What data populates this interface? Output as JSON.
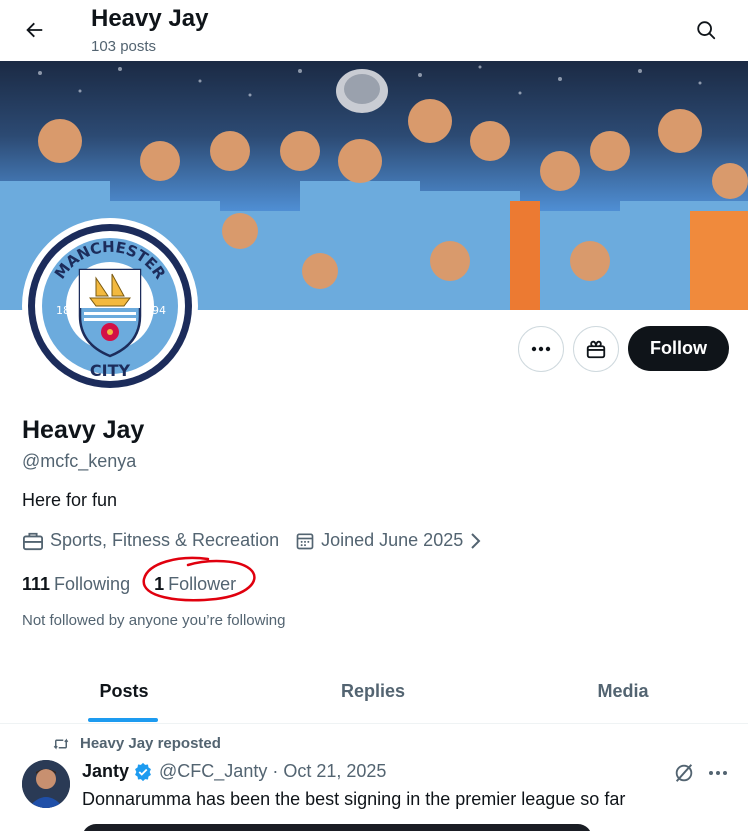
{
  "header": {
    "title": "Heavy Jay",
    "post_count": "103 posts"
  },
  "profile": {
    "display_name": "Heavy Jay",
    "handle": "@mcfc_kenya",
    "bio": "Here for fun",
    "category": "Sports, Fitness & Recreation",
    "joined": "Joined June 2025",
    "following_count": "111",
    "following_label": "Following",
    "followers_count": "1",
    "followers_label": "Follower",
    "not_followed_note": "Not followed by anyone you’re following",
    "follow_label": "Follow"
  },
  "crest": {
    "top_text": "MANCHESTER",
    "bottom_text": "CITY",
    "left_num": "18",
    "right_num": "94"
  },
  "tabs": [
    {
      "label": "Posts",
      "active": true
    },
    {
      "label": "Replies",
      "active": false
    },
    {
      "label": "Media",
      "active": false
    }
  ],
  "tweet": {
    "repost_label": "Heavy Jay reposted",
    "author_name": "Janty",
    "author_handle": "@CFC_Janty",
    "separator": "·",
    "date": "Oct 21, 2025",
    "text": "Donnarumma has been the best signing in the premier league so far"
  },
  "colors": {
    "accent": "#1d9bf0",
    "text": "#0f1419",
    "secondary": "#536471",
    "annotation": "#e0000e",
    "city_blue": "#6cabdd"
  }
}
